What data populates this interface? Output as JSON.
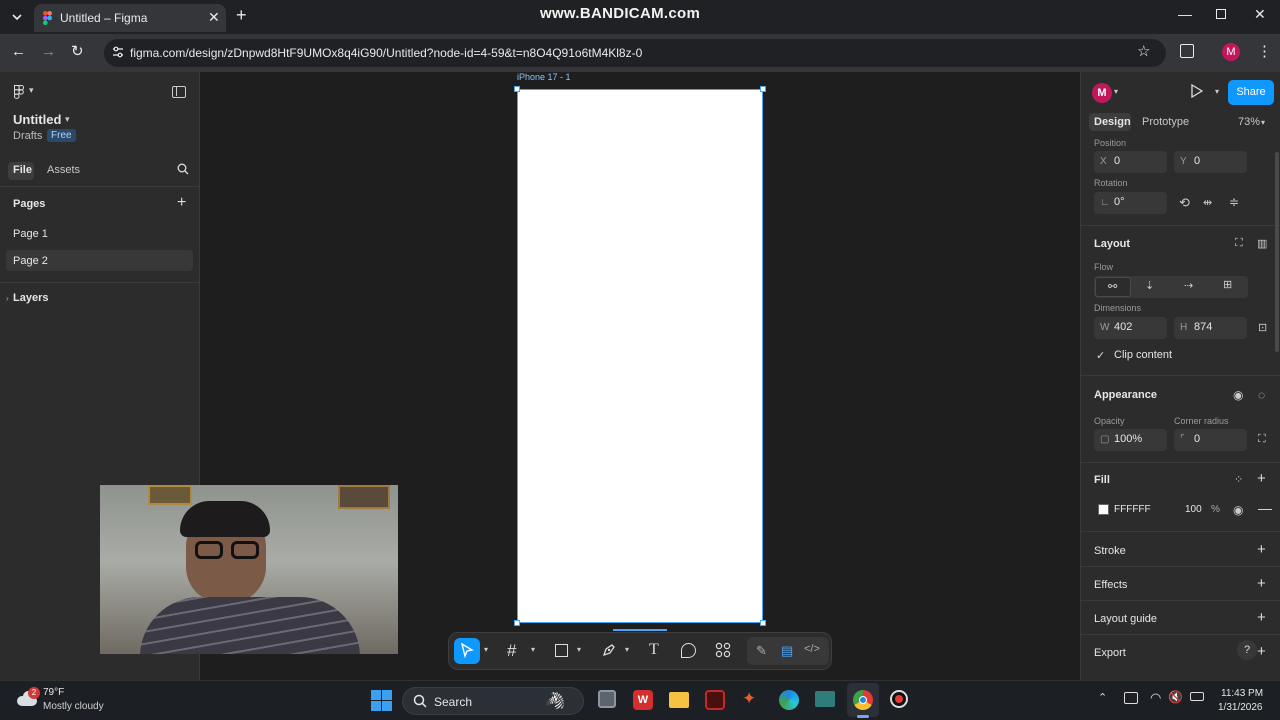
{
  "browser": {
    "tab_title": "Untitled – Figma",
    "url": "figma.com/design/zDnpwd8HtF9UMOx8q4iG90/Untitled?node-id=4-59&t=n8O4Q91o6tM4Kl8z-0",
    "watermark": "www.BANDICAM.com",
    "profile_initial": "M"
  },
  "left": {
    "file_name": "Untitled",
    "drafts": "Drafts",
    "plan": "Free",
    "tabs": [
      "File",
      "Assets"
    ],
    "pages_title": "Pages",
    "pages": [
      "Page 1",
      "Page 2"
    ],
    "layers_title": "Layers"
  },
  "canvas": {
    "frame_label": "iPhone 17 - 1",
    "frame_fill": "#FFFFFF",
    "selection_color": "#4aa3f0"
  },
  "right": {
    "avatar": "M",
    "share": "Share",
    "tabs": [
      "Design",
      "Prototype"
    ],
    "zoom": "73%",
    "position": {
      "label": "Position",
      "x_key": "X",
      "x": "0",
      "y_key": "Y",
      "y": "0"
    },
    "rotation": {
      "label": "Rotation",
      "value": "0°"
    },
    "layout": {
      "title": "Layout",
      "flow": "Flow",
      "dimensions": "Dimensions",
      "w_key": "W",
      "w": "402",
      "h_key": "H",
      "h": "874",
      "clip": "Clip content"
    },
    "appearance": {
      "title": "Appearance",
      "opacity_label": "Opacity",
      "opacity": "100%",
      "radius_label": "Corner radius",
      "radius": "0"
    },
    "fill": {
      "title": "Fill",
      "hex": "FFFFFF",
      "opacity": "100",
      "pct": "%"
    },
    "stroke": "Stroke",
    "effects": "Effects",
    "layout_guide": "Layout guide",
    "export": "Export",
    "help": "?"
  },
  "taskbar": {
    "weather_temp": "79°F",
    "weather_desc": "Mostly cloudy",
    "weather_badge": "2",
    "search": "Search",
    "time": "11:43 PM",
    "date": "1/31/2026"
  },
  "colors": {
    "accent": "#0d99ff",
    "brand_avatar": "#c2185b",
    "figma_bg": "#2c2c2c",
    "canvas_bg": "#1e1e1e"
  }
}
